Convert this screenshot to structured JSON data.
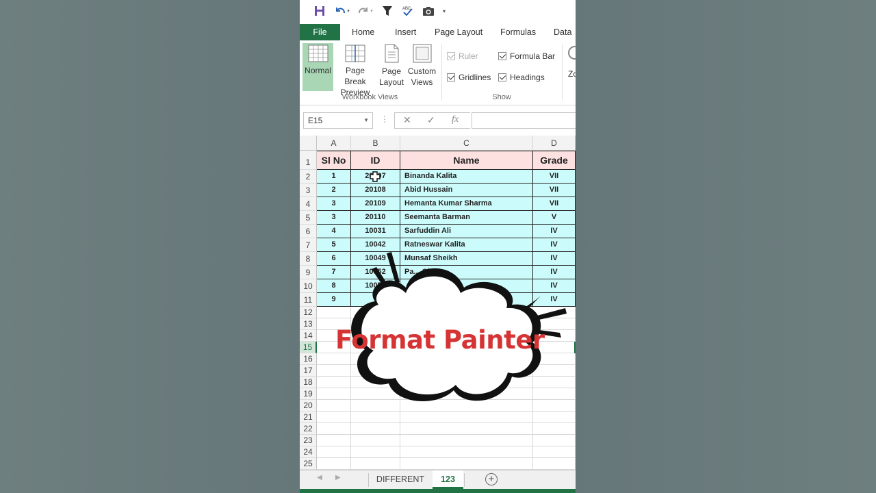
{
  "ribbon": {
    "tabs": [
      "File",
      "Home",
      "Insert",
      "Page Layout",
      "Formulas",
      "Data"
    ],
    "views": [
      {
        "line1": "Normal",
        "line2": ""
      },
      {
        "line1": "Page Break",
        "line2": "Preview"
      },
      {
        "line1": "Page",
        "line2": "Layout"
      },
      {
        "line1": "Custom",
        "line2": "Views"
      }
    ],
    "workbook_views_label": "Workbook Views",
    "show": {
      "ruler": "Ruler",
      "formula_bar": "Formula Bar",
      "gridlines": "Gridlines",
      "headings": "Headings"
    },
    "show_label": "Show",
    "zoom_partial": "Zo"
  },
  "formula_bar": {
    "name_box": "E15",
    "fx": "fx",
    "value": ""
  },
  "columns": [
    "A",
    "B",
    "C",
    "D"
  ],
  "rows": [
    "1",
    "2",
    "3",
    "4",
    "5",
    "6",
    "7",
    "8",
    "9",
    "10",
    "11",
    "12",
    "13",
    "14",
    "15",
    "16",
    "17",
    "18",
    "19",
    "20",
    "21",
    "22",
    "23",
    "24",
    "25"
  ],
  "table": {
    "headers": [
      "Sl No",
      "ID",
      "Name",
      "Grade"
    ],
    "data": [
      [
        "1",
        "20107",
        "Binanda Kalita",
        "VII"
      ],
      [
        "2",
        "20108",
        "Abid Hussain",
        "VII"
      ],
      [
        "3",
        "20109",
        "Hemanta Kumar Sharma",
        "VII"
      ],
      [
        "3",
        "20110",
        "Seemanta Barman",
        "V"
      ],
      [
        "4",
        "10031",
        "Sarfuddin Ali",
        "IV"
      ],
      [
        "5",
        "10042",
        "Ratneswar Kalita",
        "IV"
      ],
      [
        "6",
        "10049",
        "Munsaf Sheikh",
        "IV"
      ],
      [
        "7",
        "10052",
        "Pa... Chetry",
        "IV"
      ],
      [
        "8",
        "10053",
        "",
        "IV"
      ],
      [
        "9",
        "",
        "",
        "IV"
      ]
    ]
  },
  "sheets": [
    "DIFFERENT",
    "123"
  ],
  "overlay": {
    "text": "Format Painter"
  },
  "colors": {
    "excel_green": "#217346",
    "header_fill": "#fde1e1",
    "data_fill": "#ccfbfb",
    "overlay_text": "#d63434"
  }
}
